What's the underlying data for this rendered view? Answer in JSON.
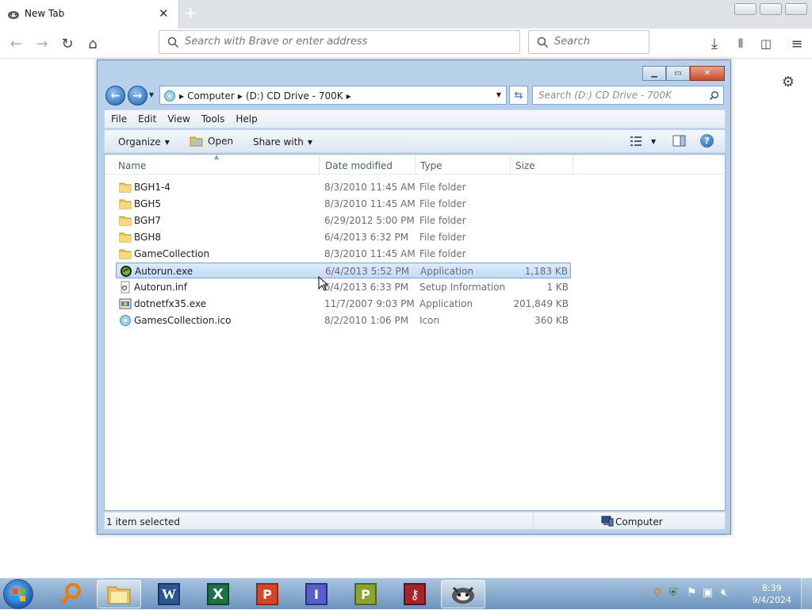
{
  "browser": {
    "tab_title": "New Tab",
    "address_placeholder": "Search with Brave or enter address",
    "search_placeholder": "Search"
  },
  "explorer": {
    "breadcrumbs": [
      "Computer",
      "(D:) CD Drive - 700K"
    ],
    "search_placeholder": "Search (D:) CD Drive - 700K",
    "menus": [
      "File",
      "Edit",
      "View",
      "Tools",
      "Help"
    ],
    "commands": {
      "organize": "Organize",
      "open": "Open",
      "share_with": "Share with"
    },
    "columns": {
      "name": "Name",
      "date": "Date modified",
      "type": "Type",
      "size": "Size"
    },
    "files": [
      {
        "name": "BGH1-4",
        "date": "8/3/2010 11:45 AM",
        "type": "File folder",
        "size": "",
        "icon": "folder-icon"
      },
      {
        "name": "BGH5",
        "date": "8/3/2010 11:45 AM",
        "type": "File folder",
        "size": "",
        "icon": "folder-icon"
      },
      {
        "name": "BGH7",
        "date": "6/29/2012 5:00 PM",
        "type": "File folder",
        "size": "",
        "icon": "folder-icon"
      },
      {
        "name": "BGH8",
        "date": "6/4/2013 6:32 PM",
        "type": "File folder",
        "size": "",
        "icon": "folder-icon"
      },
      {
        "name": "GameCollection",
        "date": "8/3/2010 11:45 AM",
        "type": "File folder",
        "size": "",
        "icon": "folder-icon"
      },
      {
        "name": "Autorun.exe",
        "date": "6/4/2013 5:52 PM",
        "type": "Application",
        "size": "1,183 KB",
        "icon": "app-icon",
        "selected": true
      },
      {
        "name": "Autorun.inf",
        "date": "6/4/2013 6:33 PM",
        "type": "Setup Information",
        "size": "1 KB",
        "icon": "settings-file-icon"
      },
      {
        "name": "dotnetfx35.exe",
        "date": "11/7/2007 9:03 PM",
        "type": "Application",
        "size": "201,849 KB",
        "icon": "installer-icon"
      },
      {
        "name": "GamesCollection.ico",
        "date": "8/2/2010 1:06 PM",
        "type": "Icon",
        "size": "360 KB",
        "icon": "ico-file-icon"
      }
    ],
    "status_text": "1 item selected",
    "status_location": "Computer"
  },
  "taskbar": {
    "time": "8:39",
    "date": "9/4/2024"
  }
}
